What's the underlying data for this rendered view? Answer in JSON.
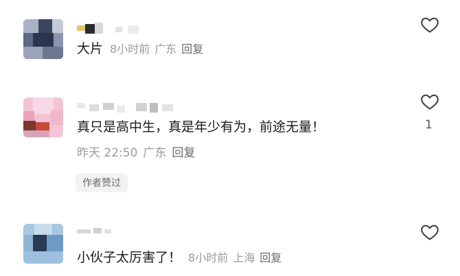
{
  "comments": [
    {
      "text": "大片",
      "meta": {
        "time": "8小时前",
        "location": "广东",
        "reply": "回复"
      },
      "likes": ""
    },
    {
      "text": "真只是高中生，真是年少有为，前途无量！",
      "meta": {
        "time": "昨天 22:50",
        "location": "广东",
        "reply": "回复"
      },
      "badge": "作者赞过",
      "likes": "1"
    },
    {
      "text": "小伙子太厉害了！",
      "meta": {
        "time": "8小时前",
        "location": "上海",
        "reply": "回复"
      },
      "likes": ""
    }
  ],
  "icons": {
    "like": "heart-outline-icon",
    "avatar": "pixelated-avatar"
  },
  "colors": {
    "meta": "#9a9a9a",
    "reply": "#6a6a6a",
    "badge_bg": "#f2f2f2"
  }
}
